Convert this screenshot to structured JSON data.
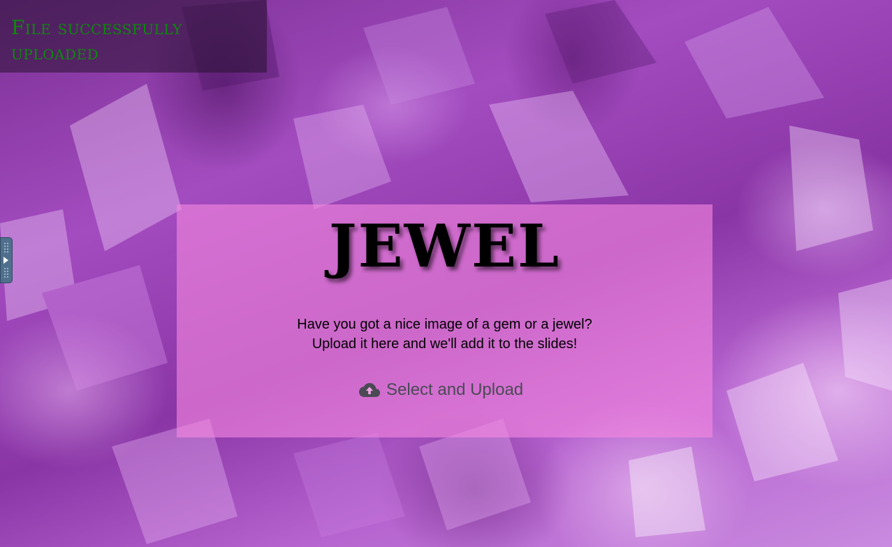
{
  "notification": {
    "message": "File successfully uploaded",
    "color": "#0c8a0c"
  },
  "card": {
    "title": "JEWEL",
    "description_line1": "Have you got a nice image of a gem or a jewel?",
    "description_line2": "Upload it here and we'll add it to the slides!",
    "upload_button": {
      "label": "Select and Upload",
      "icon": "cloud-upload-icon"
    },
    "background_color": "#f587e1"
  },
  "side_panel_toggle": {
    "icon": "play-arrow-icon"
  }
}
